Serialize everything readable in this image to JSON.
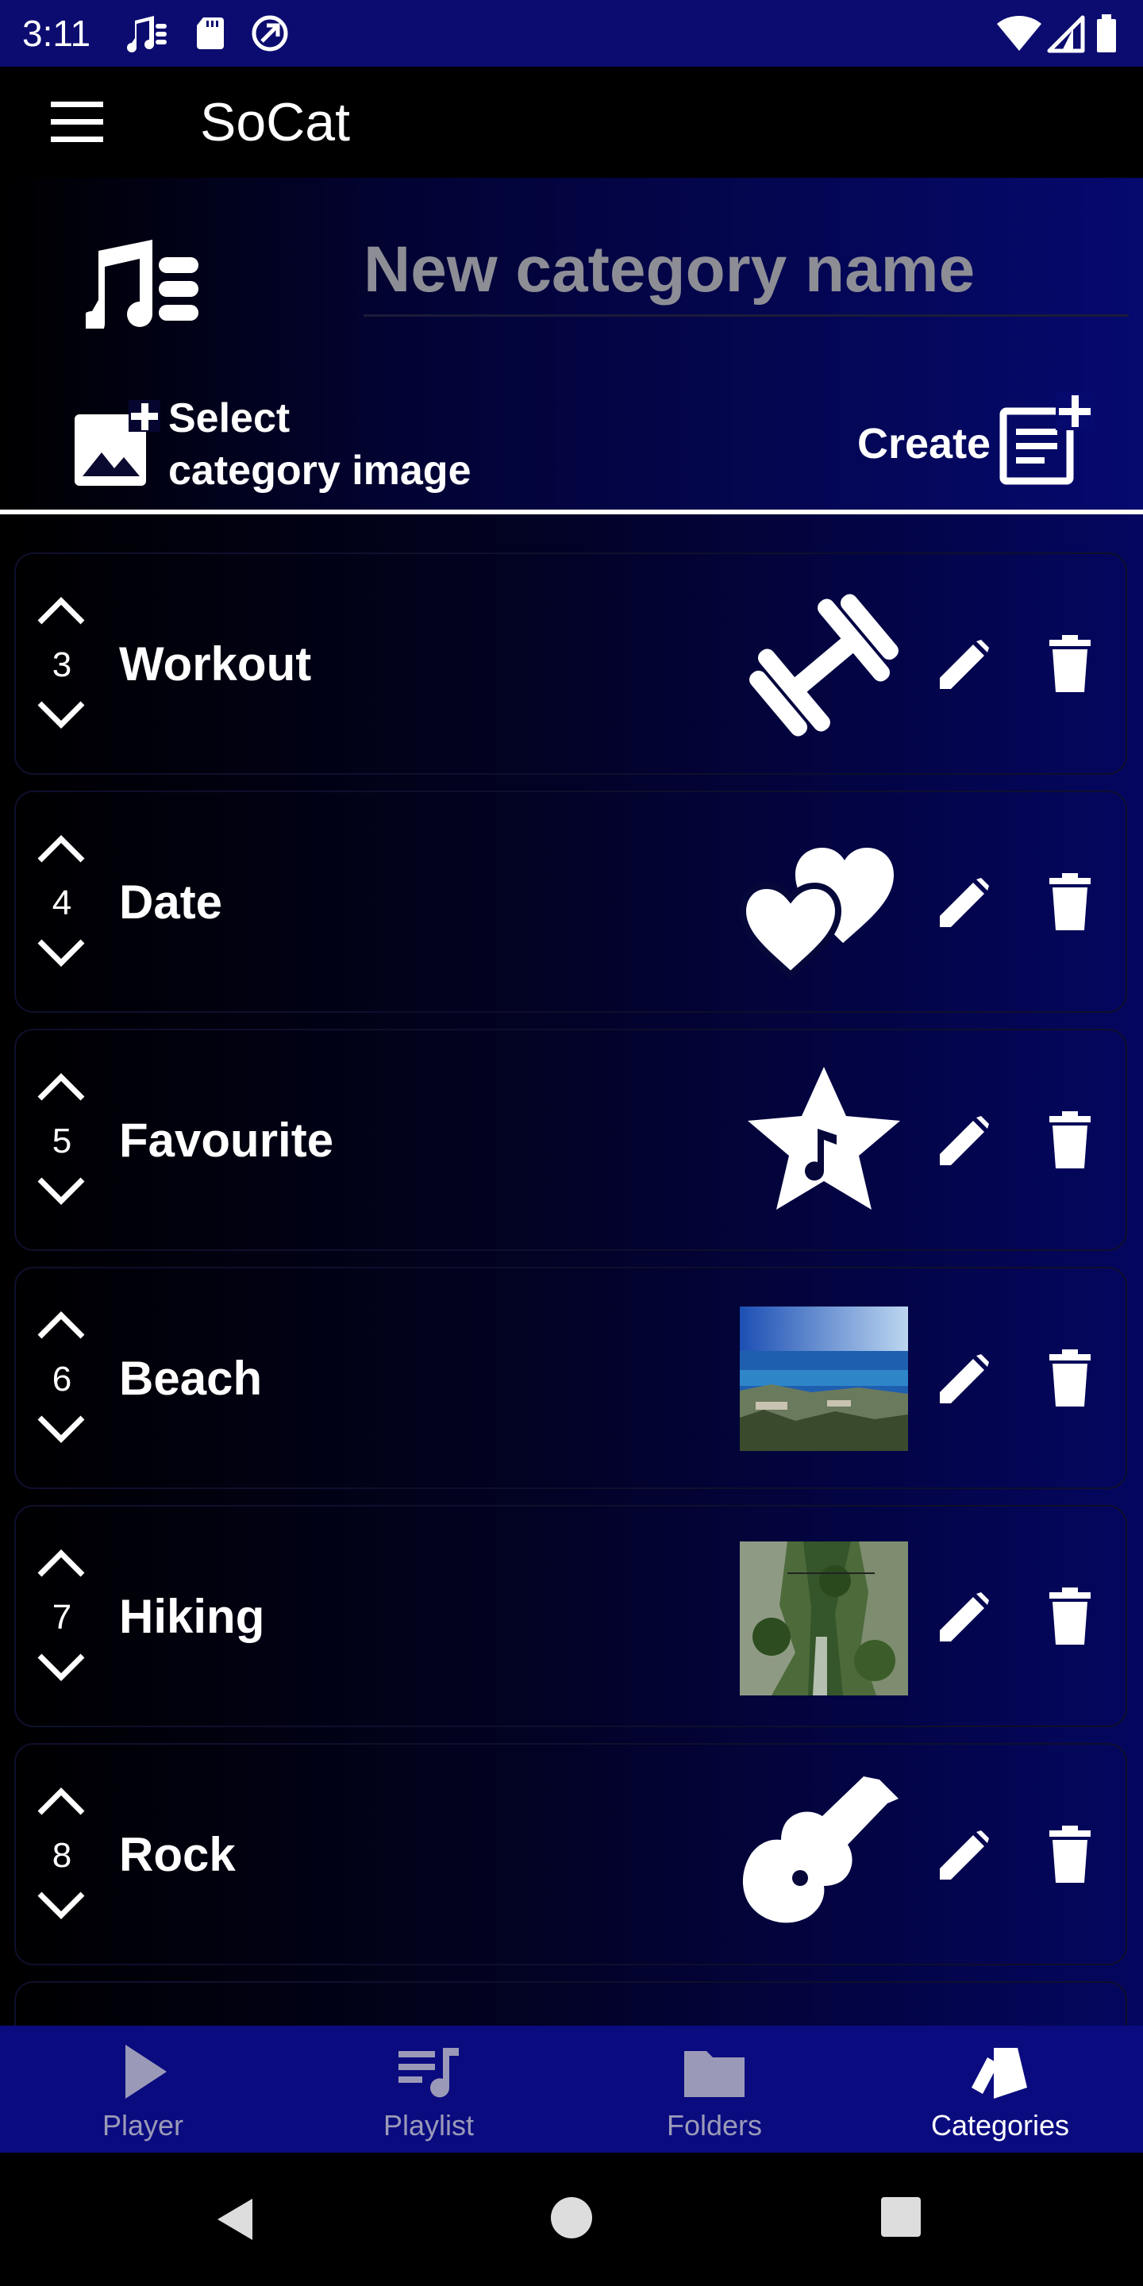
{
  "status_bar": {
    "time": "3:11",
    "left_icons": [
      "music-library-icon",
      "sd-card-icon",
      "sync-icon"
    ],
    "right_icons": [
      "wifi-icon",
      "signal-icon",
      "battery-icon"
    ]
  },
  "app_bar": {
    "title": "SoCat",
    "menu_icon": "hamburger-menu-icon"
  },
  "new_category": {
    "name_placeholder": "New category name",
    "select_image_label_line1": "Select",
    "select_image_label_line2": "category image",
    "create_label": "Create"
  },
  "categories": [
    {
      "order": "3",
      "name": "Workout",
      "image": "dumbbell-icon"
    },
    {
      "order": "4",
      "name": "Date",
      "image": "hearts-icon"
    },
    {
      "order": "5",
      "name": "Favourite",
      "image": "star-music-icon"
    },
    {
      "order": "6",
      "name": "Beach",
      "image": "beach-photo"
    },
    {
      "order": "7",
      "name": "Hiking",
      "image": "hiking-photo"
    },
    {
      "order": "8",
      "name": "Rock",
      "image": "guitar-icon"
    }
  ],
  "bottom_nav": [
    {
      "label": "Player",
      "icon": "play-icon",
      "active": false
    },
    {
      "label": "Playlist",
      "icon": "playlist-icon",
      "active": false
    },
    {
      "label": "Folders",
      "icon": "folder-icon",
      "active": false
    },
    {
      "label": "Categories",
      "icon": "categories-icon",
      "active": true
    }
  ],
  "colors": {
    "status_bar": "#0c0c70",
    "bottom_nav": "#0b0b80",
    "accent_blue": "#06096e",
    "inactive_label": "#9a9ab8"
  }
}
